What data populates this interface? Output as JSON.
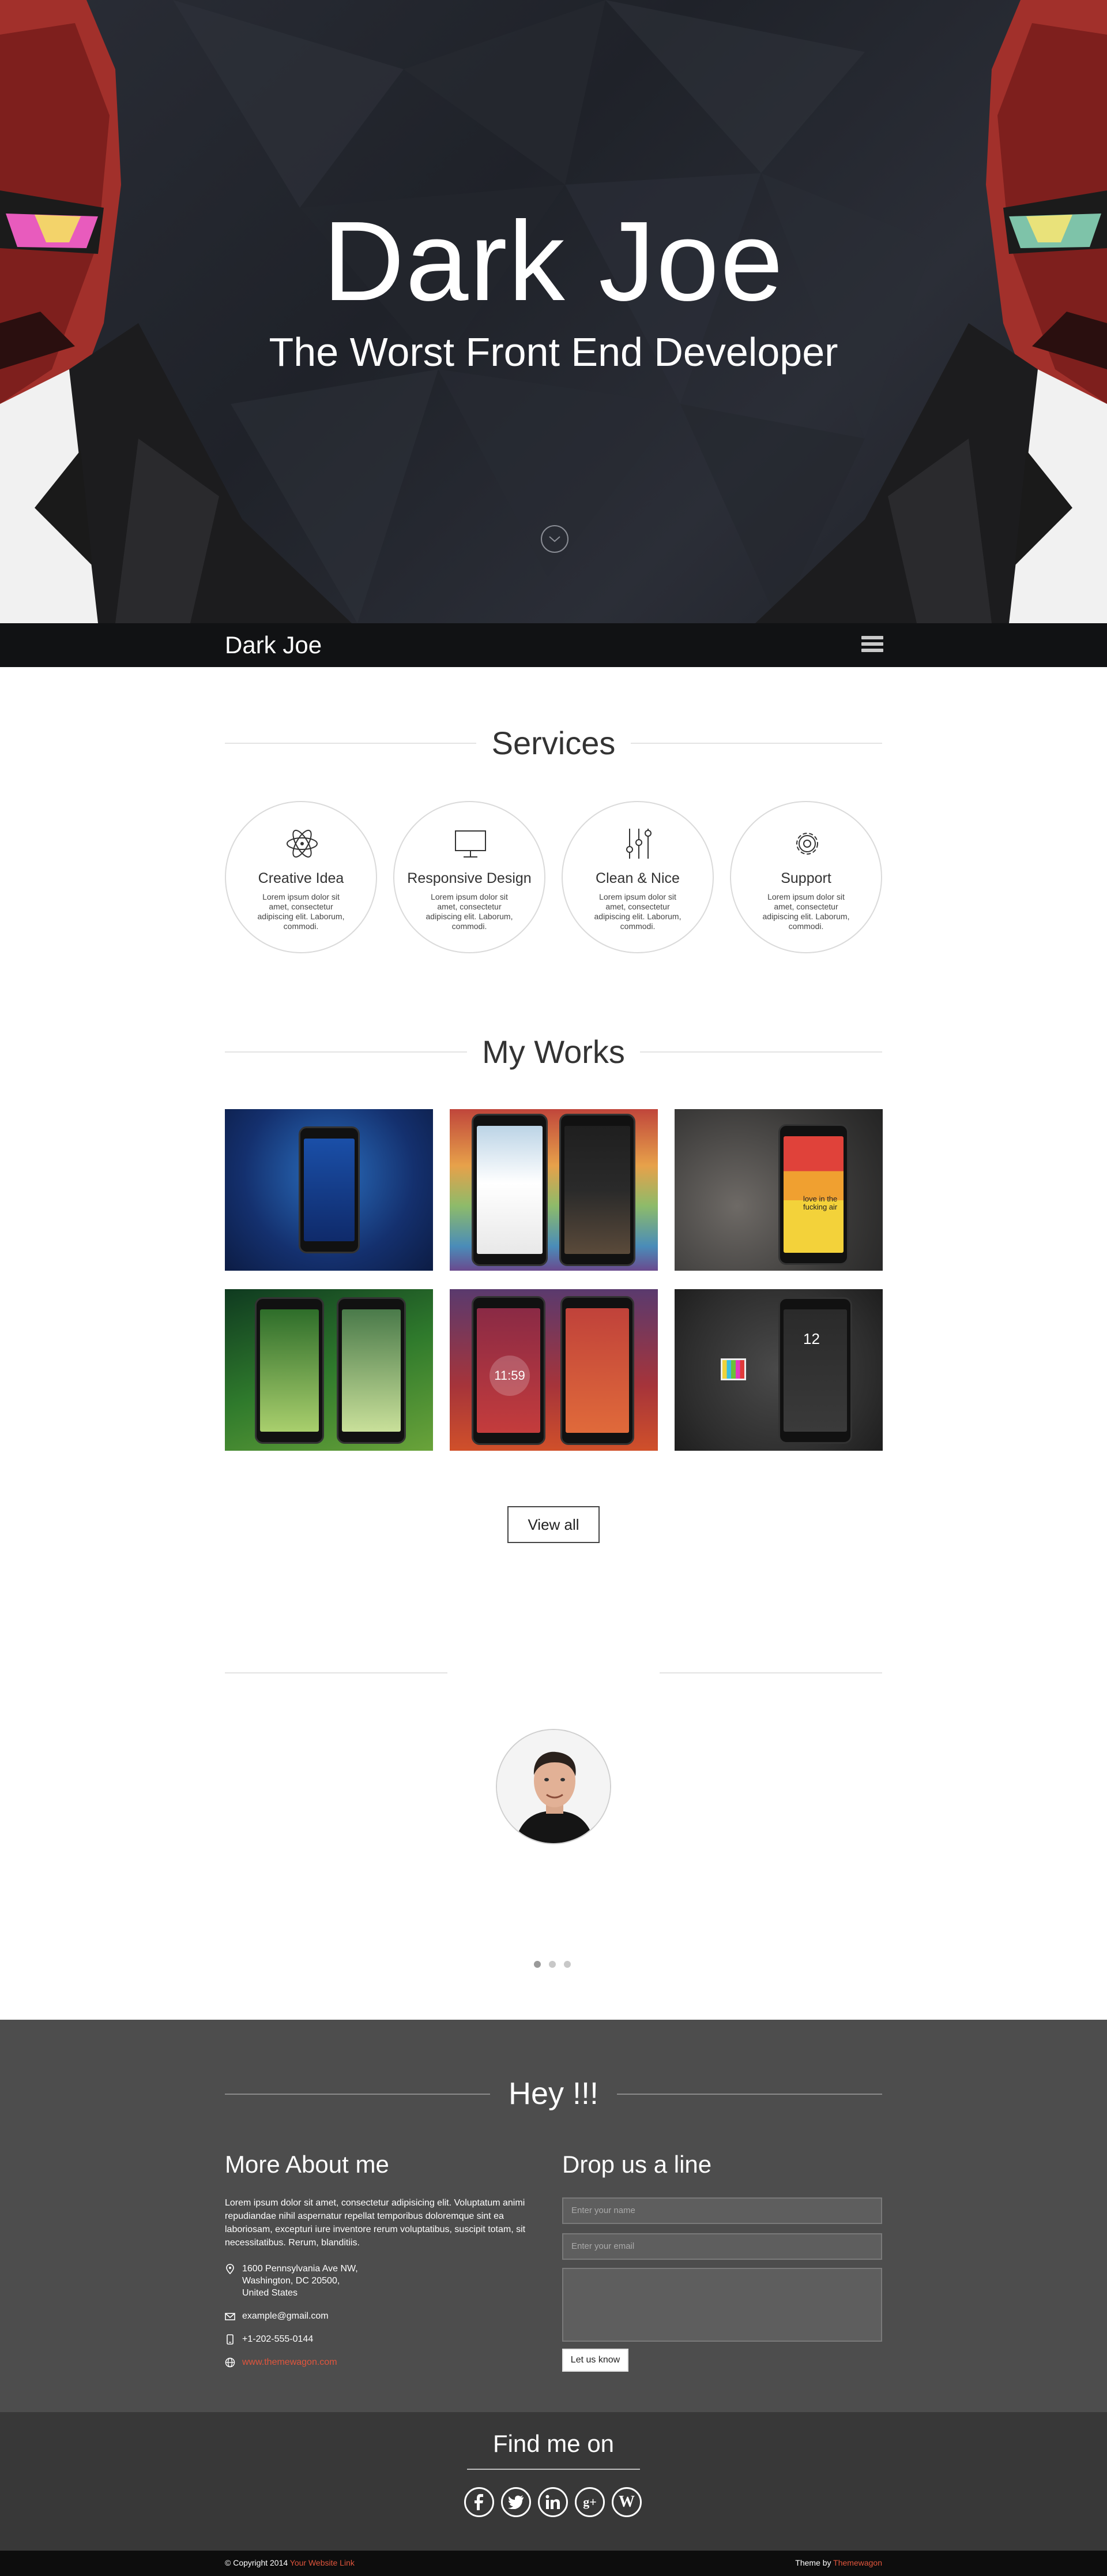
{
  "hero": {
    "title": "Dark Joe",
    "subtitle": "The Worst Front End Developer",
    "scroll_icon": "chevron-down-circle-icon"
  },
  "navbar": {
    "brand": "Dark Joe",
    "menu_icon": "hamburger-menu-icon"
  },
  "services": {
    "heading": "Services",
    "items": [
      {
        "name": "Creative Idea",
        "icon": "atom-icon",
        "desc": "Lorem ipsum dolor sit amet, consectetur adipiscing elit. Laborum, commodi."
      },
      {
        "name": "Responsive Design",
        "icon": "monitor-icon",
        "desc": "Lorem ipsum dolor sit amet, consectetur adipiscing elit. Laborum, commodi."
      },
      {
        "name": "Clean & Nice",
        "icon": "sliders-icon",
        "desc": "Lorem ipsum dolor sit amet, consectetur adipiscing elit. Laborum, commodi."
      },
      {
        "name": "Support",
        "icon": "gear-icon",
        "desc": "Lorem ipsum dolor sit amet, consectetur adipiscing elit. Laborum, commodi."
      }
    ]
  },
  "works": {
    "heading": "My Works",
    "view_all": "View all",
    "thumb_text": [
      "11:59",
      "12",
      "love in the fucking air"
    ]
  },
  "testimonial": {
    "dots": 3,
    "active_dot": 0
  },
  "contact": {
    "heading": "Hey !!!",
    "about_title": "More About me",
    "about_text": "Lorem ipsum dolor sit amet, consectetur adipisicing elit. Voluptatum animi repudiandae nihil aspernatur repellat temporibus doloremque sint ea laboriosam, excepturi iure inventore rerum voluptatibus, suscipit totam, sit necessitatibus. Rerum, blanditiis.",
    "address": "1600 Pennsylvania Ave NW,\nWashington, DC 20500,\nUnited States",
    "email": "example@gmail.com",
    "phone": "+1-202-555-0144",
    "website": "www.themewagon.com",
    "drop_title": "Drop us a line",
    "name_placeholder": "Enter your name",
    "email_placeholder": "Enter your email",
    "send_label": "Let us know"
  },
  "social": {
    "heading": "Find me on",
    "icons": [
      "facebook-icon",
      "twitter-icon",
      "linkedin-icon",
      "google-plus-icon",
      "wordpress-icon"
    ]
  },
  "footer": {
    "copyright": "© Copyright 2014",
    "copyright_link": "Your Website Link",
    "theme_by": "Theme by",
    "theme_link": "Themewagon"
  },
  "colors": {
    "accent": "#e0553c",
    "contact_bg": "#4d4d4d",
    "social_bg": "#383838",
    "navbar_bg": "#111214"
  }
}
